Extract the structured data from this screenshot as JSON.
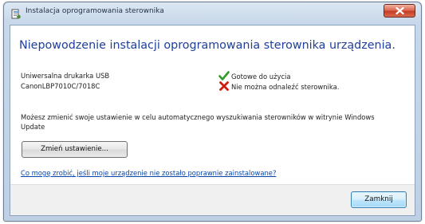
{
  "window": {
    "title": "Instalacja oprogramowania sterownika"
  },
  "main": {
    "heading": "Niepowodzenie instalacji oprogramowania sterownika urządzenia.",
    "devices": [
      {
        "name": "Uniwersalna drukarka USB",
        "status": "Gotowe do użycia",
        "status_icon": "check-icon",
        "status_color": "#2f9a2a"
      },
      {
        "name": "CanonLBP7010C/7018C",
        "status": "Nie można odnaleźć sterownika.",
        "status_icon": "error-x-icon",
        "status_color": "#d01c0f"
      }
    ],
    "info": "Możesz zmienić swoje ustawienie w celu automatycznego wyszukiwania sterowników w witrynie Windows Update",
    "change_button": "Zmień ustawienie...",
    "help_link": "Co mogę zrobić, jeśli moje urządzenie nie zostało poprawnie zainstalowane?"
  },
  "footer": {
    "close_button": "Zamknij"
  }
}
